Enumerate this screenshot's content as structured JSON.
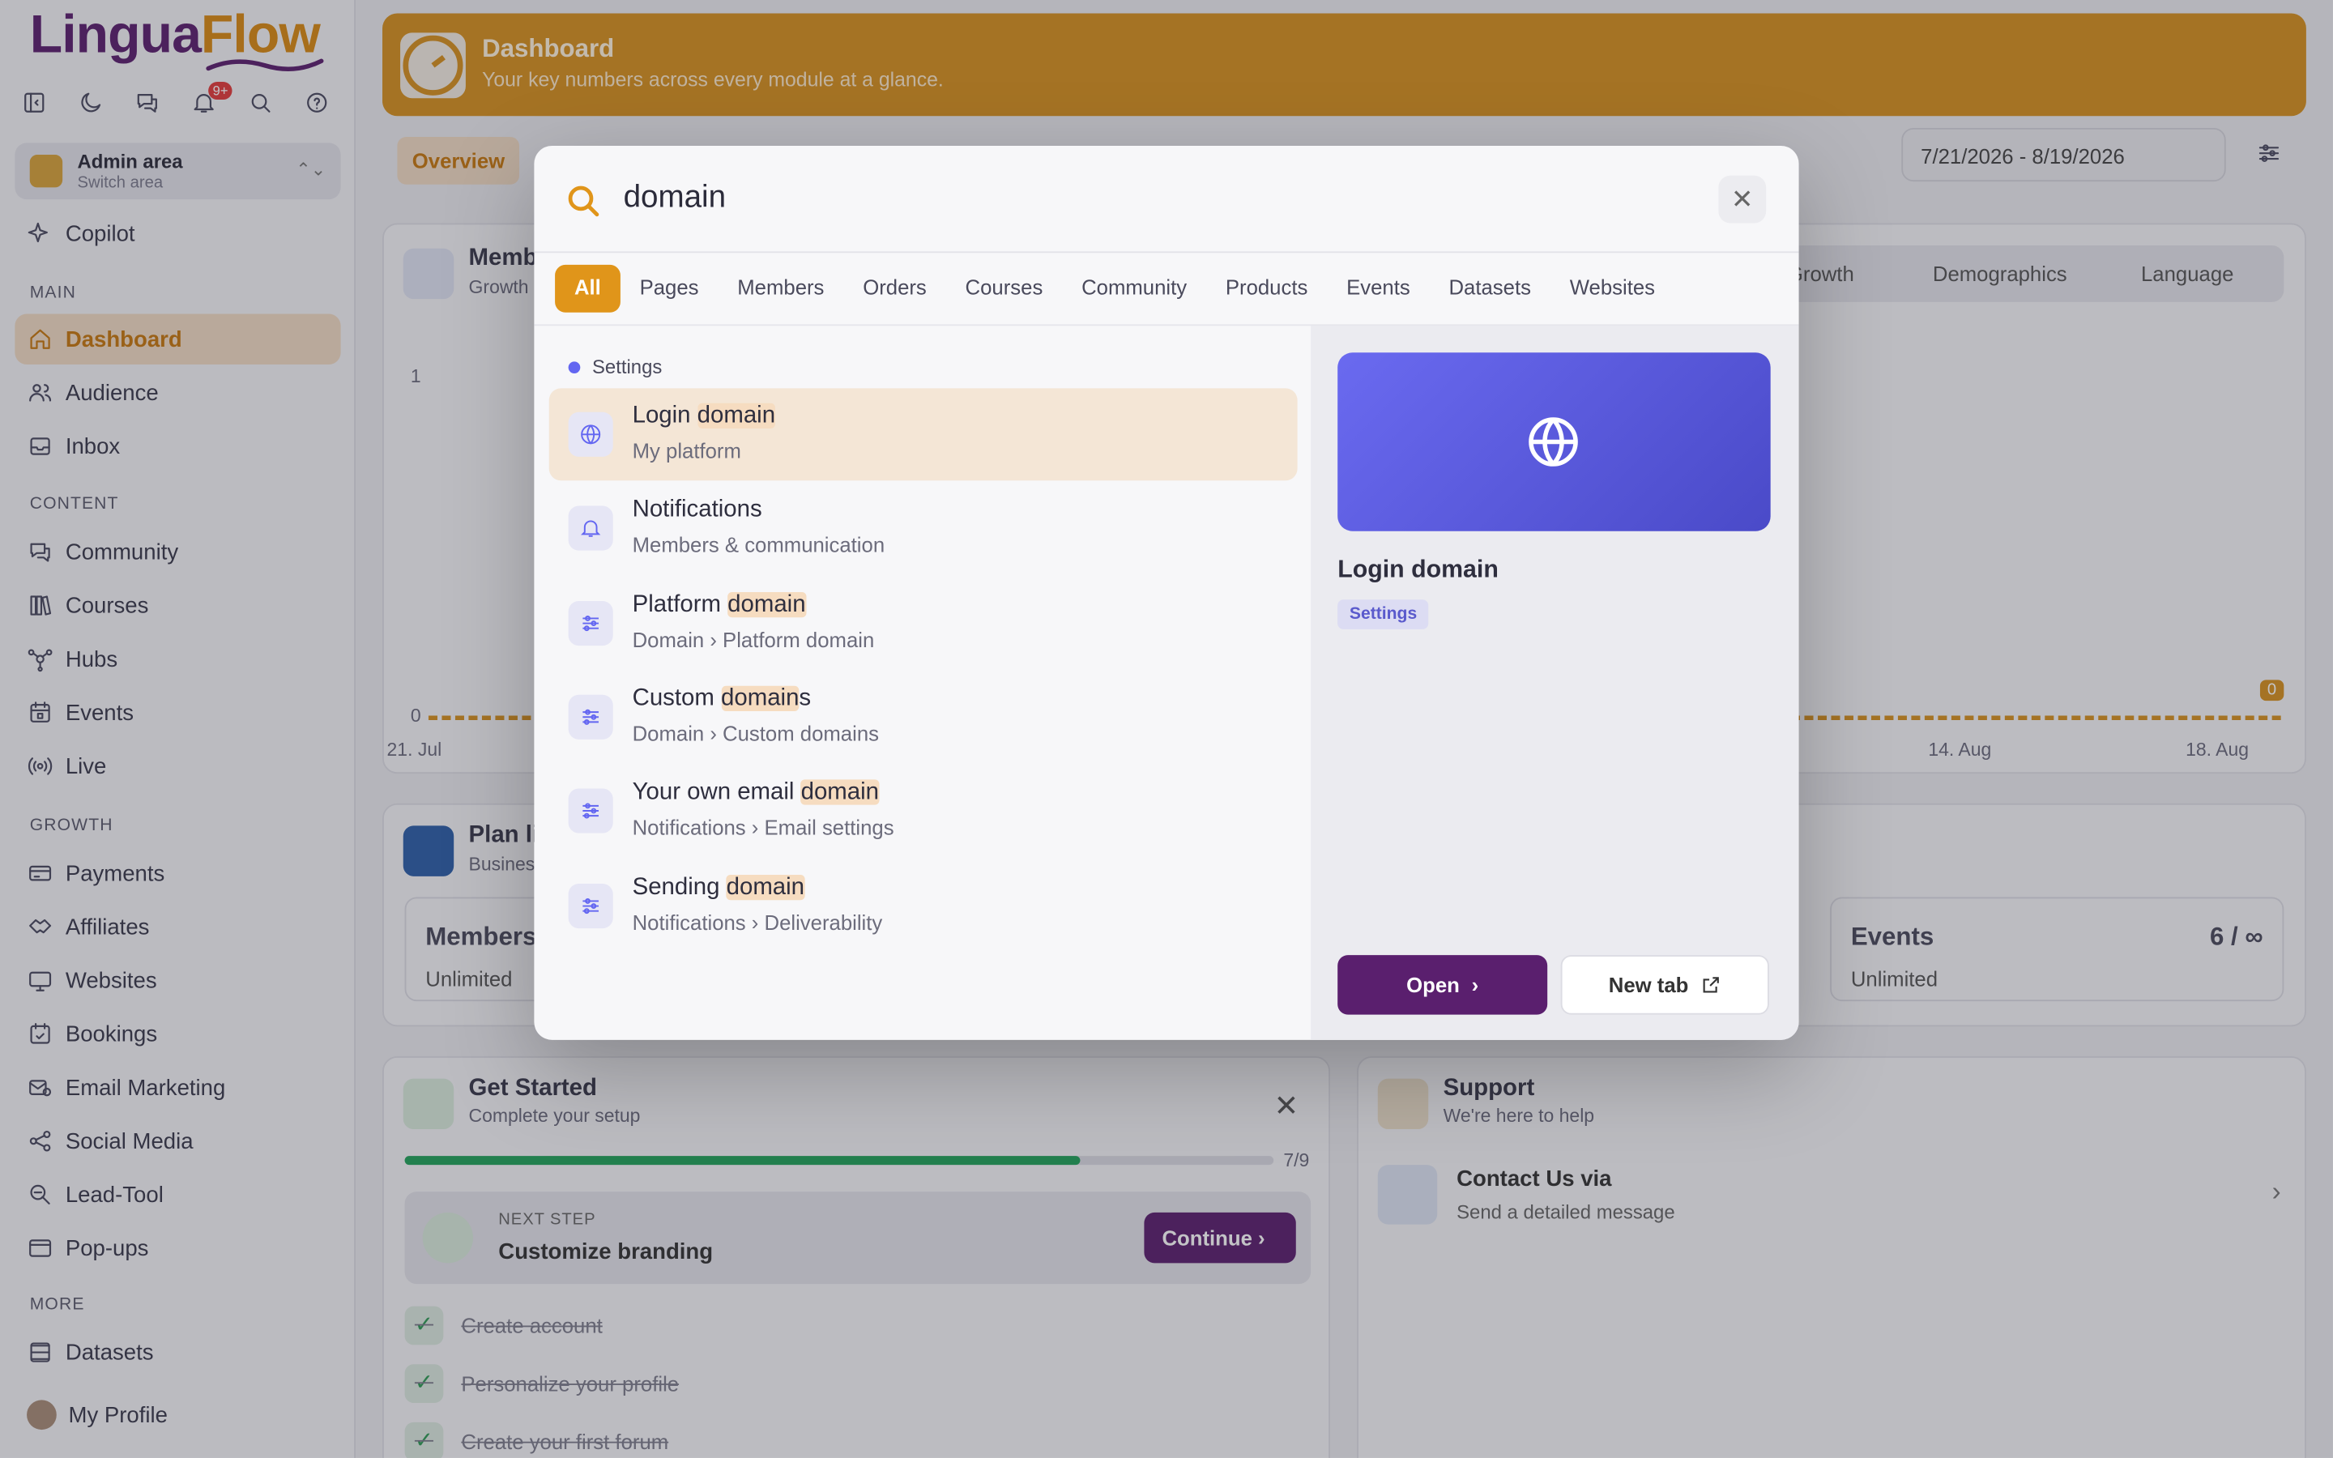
{
  "app": {
    "logo_part1": "Lingua",
    "logo_part2": "Flow",
    "notif_badge": "9+"
  },
  "area": {
    "title": "Admin area",
    "subtitle": "Switch area"
  },
  "sidebar": {
    "copilot": "Copilot",
    "sections": {
      "main": "MAIN",
      "content": "CONTENT",
      "growth": "GROWTH",
      "more": "MORE"
    },
    "items": [
      {
        "label": "Dashboard",
        "icon": "home-icon"
      },
      {
        "label": "Audience",
        "icon": "users-icon"
      },
      {
        "label": "Inbox",
        "icon": "inbox-icon"
      },
      {
        "label": "Community",
        "icon": "chat-icon"
      },
      {
        "label": "Courses",
        "icon": "book-icon"
      },
      {
        "label": "Hubs",
        "icon": "hub-icon"
      },
      {
        "label": "Events",
        "icon": "calendar-icon"
      },
      {
        "label": "Live",
        "icon": "broadcast-icon"
      },
      {
        "label": "Payments",
        "icon": "card-icon"
      },
      {
        "label": "Affiliates",
        "icon": "handshake-icon"
      },
      {
        "label": "Websites",
        "icon": "monitor-icon"
      },
      {
        "label": "Bookings",
        "icon": "calendar-check-icon"
      },
      {
        "label": "Email Marketing",
        "icon": "mail-icon"
      },
      {
        "label": "Social Media",
        "icon": "share-icon"
      },
      {
        "label": "Lead-Tool",
        "icon": "lead-icon"
      },
      {
        "label": "Pop-ups",
        "icon": "popup-icon"
      },
      {
        "label": "Datasets",
        "icon": "database-icon"
      },
      {
        "label": "My Profile",
        "icon": "avatar"
      }
    ]
  },
  "header": {
    "title": "Dashboard",
    "subtitle": "Your key numbers across every module at a glance."
  },
  "subnav": {
    "overview": "Overview",
    "date_range": "7/21/2026 - 8/19/2026"
  },
  "members_card": {
    "title": "Memb",
    "subtitle": "Growth",
    "tabs": [
      "Growth",
      "Demographics",
      "Language"
    ],
    "y_top": "1",
    "y_bottom": "0",
    "x_labels": [
      "21. Jul",
      "14. Aug",
      "18. Aug"
    ],
    "end_value": "0"
  },
  "plan_card": {
    "title": "Plan li",
    "subtitle": "Busines",
    "members_label": "Members",
    "members_value": "Unlimited",
    "events_label": "Events",
    "events_count": "6 / ∞",
    "events_value": "Unlimited"
  },
  "get_started": {
    "title": "Get Started",
    "subtitle": "Complete your setup",
    "progress_text": "7/9",
    "progress_value": 0.778,
    "next_label": "NEXT STEP",
    "next_title": "Customize branding",
    "continue": "Continue",
    "done": [
      "Create account",
      "Personalize your profile",
      "Create your first forum"
    ]
  },
  "support": {
    "title": "Support",
    "subtitle": "We're here to help",
    "contact_title": "Contact Us via",
    "contact_sub": "Send a detailed message"
  },
  "search": {
    "query": "domain",
    "filters": [
      "All",
      "Pages",
      "Members",
      "Orders",
      "Courses",
      "Community",
      "Products",
      "Events",
      "Datasets",
      "Websites"
    ],
    "group": "Settings",
    "results": [
      {
        "pre": "Login ",
        "hl": "domain",
        "post": "",
        "sub": "My platform",
        "icon": "globe-icon"
      },
      {
        "pre": "Notifications",
        "hl": "",
        "post": "",
        "sub": "Members & communication",
        "icon": "bell-icon"
      },
      {
        "pre": "Platform ",
        "hl": "domain",
        "post": "",
        "sub": "Domain › Platform domain",
        "icon": "sliders-icon"
      },
      {
        "pre": "Custom ",
        "hl": "domain",
        "post": "s",
        "sub": "Domain › Custom domains",
        "icon": "sliders-icon"
      },
      {
        "pre": "Your own email ",
        "hl": "domain",
        "post": "",
        "sub": "Notifications › Email settings",
        "icon": "sliders-icon"
      },
      {
        "pre": "Sending ",
        "hl": "domain",
        "post": "",
        "sub": "Notifications › Deliverability",
        "icon": "sliders-icon"
      }
    ],
    "preview": {
      "title": "Login domain",
      "tag": "Settings",
      "open": "Open",
      "new_tab": "New tab"
    }
  },
  "colors": {
    "accent": "#e0951a",
    "brand": "#5a1f6e",
    "preview": "#5b5be0"
  }
}
